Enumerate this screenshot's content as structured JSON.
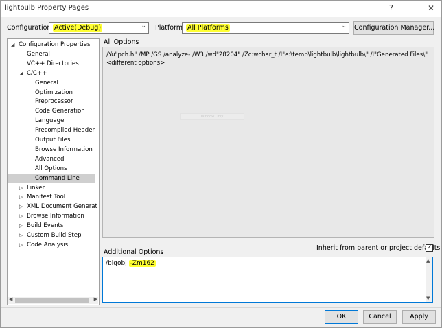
{
  "window": {
    "title": "lightbulb Property Pages",
    "help_glyph": "?",
    "close_glyph": "✕"
  },
  "config_bar": {
    "configuration_label": "Configuration:",
    "configuration_value": "Active(Debug)",
    "platform_label": "Platform:",
    "platform_value": "All Platforms",
    "config_manager_label": "Configuration Manager..."
  },
  "tree": {
    "items": [
      {
        "label": "Configuration Properties",
        "level": 0,
        "expander": "◢"
      },
      {
        "label": "General",
        "level": 1,
        "expander": ""
      },
      {
        "label": "VC++ Directories",
        "level": 1,
        "expander": ""
      },
      {
        "label": "C/C++",
        "level": 1,
        "expander": "◢"
      },
      {
        "label": "General",
        "level": 2,
        "expander": ""
      },
      {
        "label": "Optimization",
        "level": 2,
        "expander": ""
      },
      {
        "label": "Preprocessor",
        "level": 2,
        "expander": ""
      },
      {
        "label": "Code Generation",
        "level": 2,
        "expander": ""
      },
      {
        "label": "Language",
        "level": 2,
        "expander": ""
      },
      {
        "label": "Precompiled Header",
        "level": 2,
        "expander": ""
      },
      {
        "label": "Output Files",
        "level": 2,
        "expander": ""
      },
      {
        "label": "Browse Information",
        "level": 2,
        "expander": ""
      },
      {
        "label": "Advanced",
        "level": 2,
        "expander": ""
      },
      {
        "label": "All Options",
        "level": 2,
        "expander": ""
      },
      {
        "label": "Command Line",
        "level": 2,
        "expander": "",
        "selected": true
      },
      {
        "label": "Linker",
        "level": 1,
        "expander": "▷"
      },
      {
        "label": "Manifest Tool",
        "level": 1,
        "expander": "▷"
      },
      {
        "label": "XML Document Generat",
        "level": 1,
        "expander": "▷"
      },
      {
        "label": "Browse Information",
        "level": 1,
        "expander": "▷"
      },
      {
        "label": "Build Events",
        "level": 1,
        "expander": "▷"
      },
      {
        "label": "Custom Build Step",
        "level": 1,
        "expander": "▷"
      },
      {
        "label": "Code Analysis",
        "level": 1,
        "expander": "▷"
      }
    ],
    "scroll_left": "◀",
    "scroll_right": "▶"
  },
  "all_options": {
    "title": "All Options",
    "line1": "/Yu\"pch.h\" /MP /GS /analyze- /W3 /wd\"28204\" /Zc:wchar_t /I\"e:\\temp\\lightbulb\\lightbulb\\\" /I\"Generated Files\\\"",
    "line2": "<different options>",
    "watermark": "Window Only"
  },
  "additional_options": {
    "title": "Additional Options",
    "inherit_label": "Inherit from parent or project defaults",
    "inherit_checked": true,
    "check_glyph": "✓",
    "text_plain": "/bigobj ",
    "text_highlighted": "-Zm162",
    "scroll_up": "▲",
    "scroll_down": "▼"
  },
  "buttons": {
    "ok": "OK",
    "cancel": "Cancel",
    "apply": "Apply"
  },
  "colors": {
    "highlight": "#ffff33",
    "accent": "#0078d7",
    "selection": "#cfcfcf"
  }
}
